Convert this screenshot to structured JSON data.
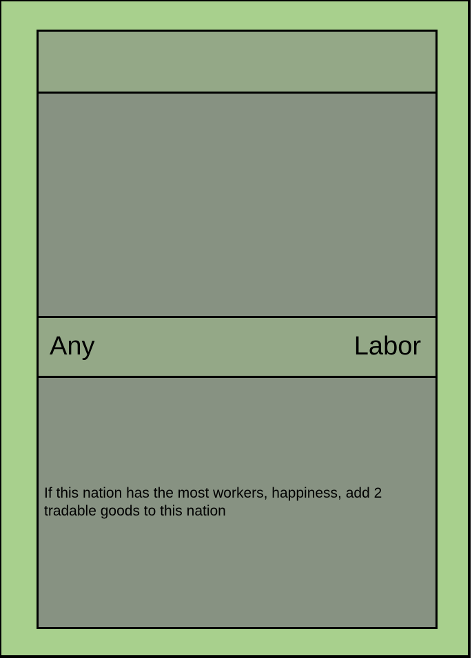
{
  "card": {
    "title": "",
    "type_left": "Any",
    "type_right": "Labor",
    "effect_text": "If this nation has the most workers, happiness, add 2 tradable goods to this nation"
  },
  "colors": {
    "outer_border_bg": "#a8d08d",
    "band": "#94a887",
    "panel": "#879282",
    "line": "#000000"
  }
}
